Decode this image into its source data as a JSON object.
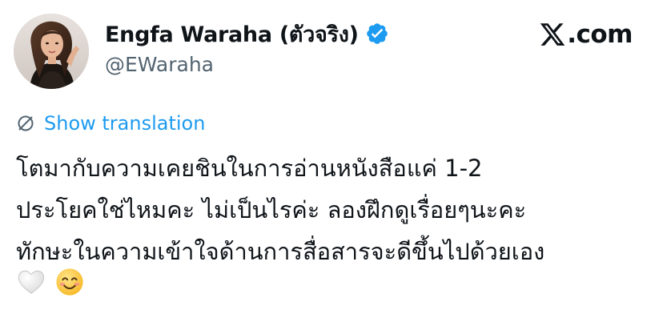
{
  "author": {
    "name": "Engfa Waraha (ตัวจริง)",
    "handle": "@EWaraha",
    "avatar_icon": "profile-photo",
    "verified_icon": "verified-badge-icon",
    "verified_color": "#1d9bf0"
  },
  "site": {
    "logo_mark": "X",
    "logo_suffix": ".com"
  },
  "translation": {
    "icon": "globe-slash-icon",
    "label": "Show translation",
    "color": "#1d9bf0"
  },
  "tweet": {
    "lines": [
      "โตมากับความเคยชินในการอ่านหนังสือแค่ 1-2",
      "ประโยคใช่ไหมคะ ไม่เป็นไรค่ะ ลองฝึกดูเรื่อยๆนะคะ",
      "ทักษะในความเข้าใจด้านการสื่อสารจะดีขึ้นไปด้วยเอง"
    ],
    "emojis": [
      "white-heart",
      "smiling-face"
    ]
  },
  "colors": {
    "text": "#0f1419",
    "secondary": "#536471",
    "background": "#ffffff"
  }
}
